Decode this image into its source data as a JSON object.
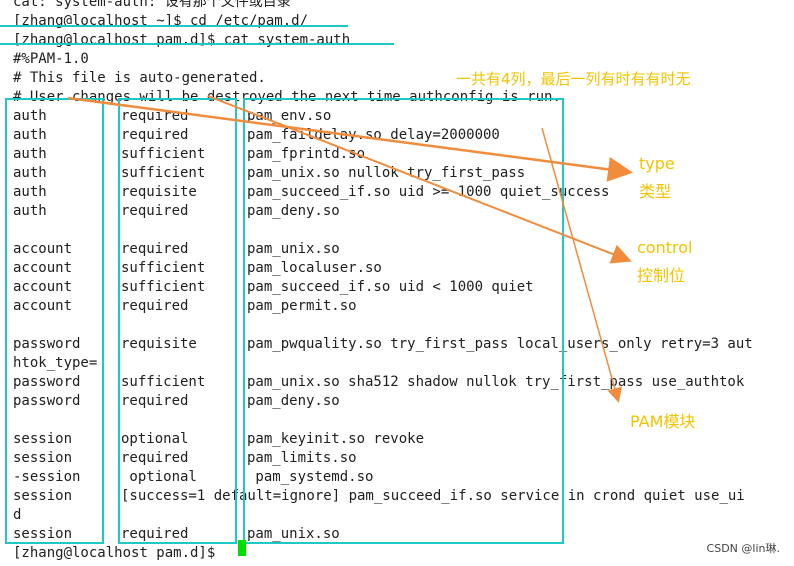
{
  "terminal": {
    "lines": [
      "cat: system-auth: 设有那个文件或目录",
      "[zhang@localhost ~]$ cd /etc/pam.d/",
      "[zhang@localhost pam.d]$ cat system-auth",
      "#%PAM-1.0",
      "# This file is auto-generated.",
      "# User changes will be destroyed the next time authconfig is run."
    ],
    "rows": [
      [
        "auth",
        "required",
        "pam_env.so"
      ],
      [
        "auth",
        "required",
        "pam_faildelay.so delay=2000000"
      ],
      [
        "auth",
        "sufficient",
        "pam_fprintd.so"
      ],
      [
        "auth",
        "sufficient",
        "pam_unix.so nullok try_first_pass"
      ],
      [
        "auth",
        "requisite",
        "pam_succeed_if.so uid >= 1000 quiet_success"
      ],
      [
        "auth",
        "required",
        "pam_deny.so"
      ],
      [
        "",
        "",
        ""
      ],
      [
        "account",
        "required",
        "pam_unix.so"
      ],
      [
        "account",
        "sufficient",
        "pam_localuser.so"
      ],
      [
        "account",
        "sufficient",
        "pam_succeed_if.so uid < 1000 quiet"
      ],
      [
        "account",
        "required",
        "pam_permit.so"
      ],
      [
        "",
        "",
        ""
      ],
      [
        "password",
        "requisite",
        "pam_pwquality.so try_first_pass local_users_only retry=3 aut"
      ],
      [
        "htok_type=",
        "",
        ""
      ],
      [
        "password",
        "sufficient",
        "pam_unix.so sha512 shadow nullok try_first_pass use_authtok"
      ],
      [
        "password",
        "required",
        "pam_deny.so"
      ],
      [
        "",
        "",
        ""
      ],
      [
        "session",
        "optional",
        "pam_keyinit.so revoke"
      ],
      [
        "session",
        "required",
        "pam_limits.so"
      ],
      [
        "-session",
        " optional",
        " pam_systemd.so"
      ],
      [
        "session",
        "[success=1 default=ignore] pam_succeed_if.so service in crond quiet use_ui",
        ""
      ],
      [
        "d",
        "",
        ""
      ],
      [
        "session",
        "required",
        "pam_unix.so"
      ]
    ],
    "prompt": "[zhang@localhost pam.d]$"
  },
  "annotations": {
    "top_note": "一共有4列，最后一列有时有有时无",
    "type_label": "type",
    "type_cn": "类型",
    "control_label": "control",
    "control_cn": "控制位",
    "module_label": "PAM模块"
  },
  "watermark": "CSDN @lin琳.",
  "colors": {
    "box": "#1fc7c7",
    "arrow": "#f08c3c",
    "annotation_text": "#f3c300",
    "cursor": "#00e000"
  }
}
